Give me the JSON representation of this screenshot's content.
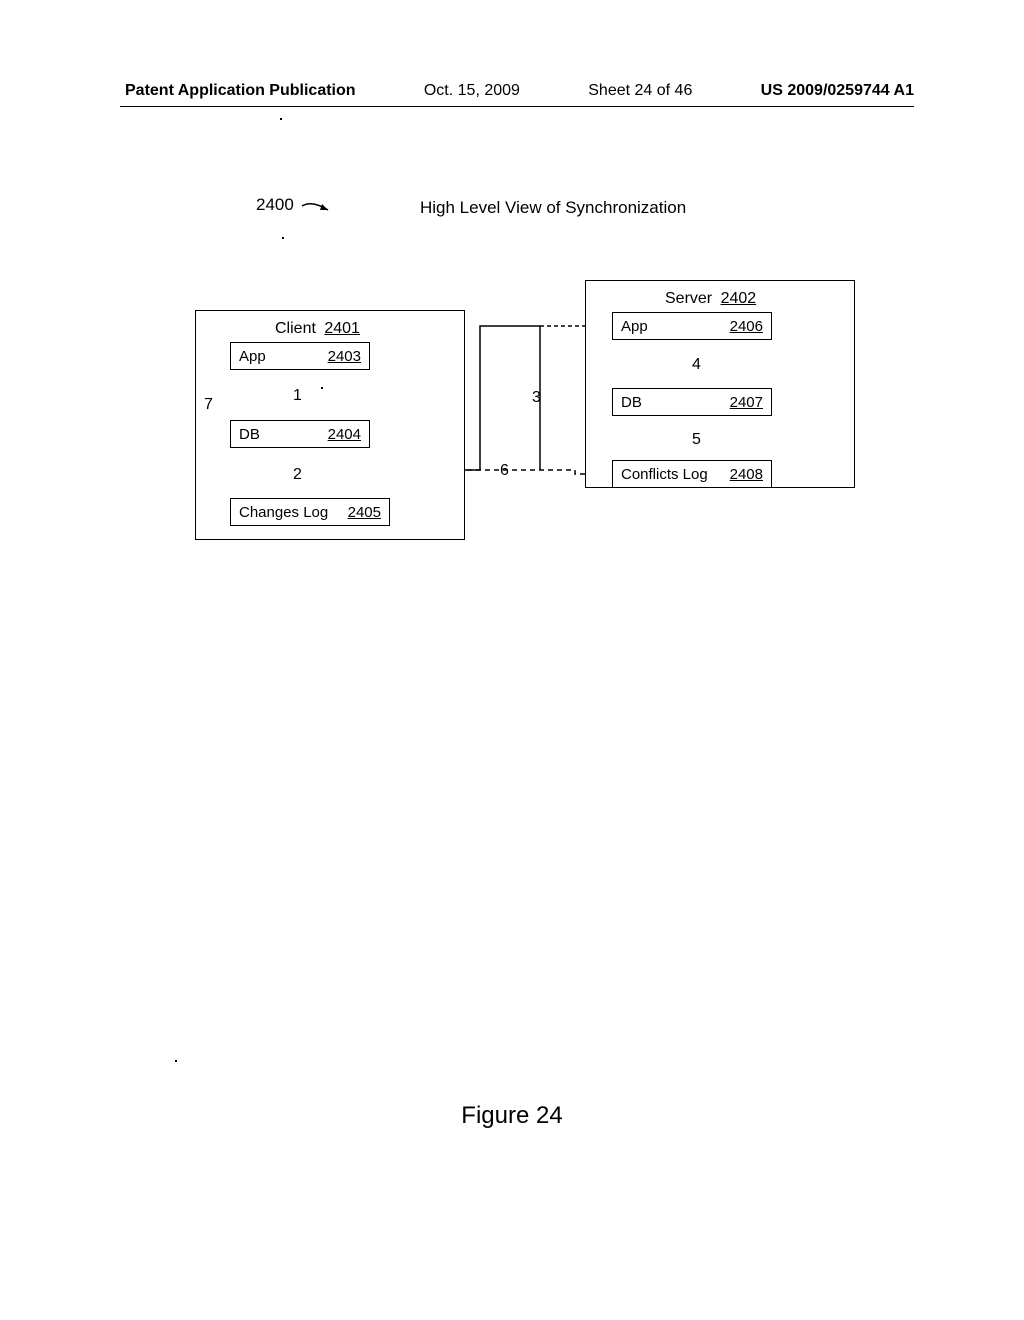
{
  "header": {
    "publication": "Patent Application Publication",
    "date": "Oct. 15, 2009",
    "sheet": "Sheet 24 of 46",
    "pubnum": "US 2009/0259744 A1"
  },
  "figure": {
    "ref": "2400",
    "title": "High Level View of Synchronization",
    "caption": "Figure 24"
  },
  "client": {
    "label": "Client",
    "ref": "2401",
    "app": {
      "label": "App",
      "ref": "2403"
    },
    "db": {
      "label": "DB",
      "ref": "2404"
    },
    "log": {
      "label": "Changes Log",
      "ref": "2405"
    }
  },
  "server": {
    "label": "Server",
    "ref": "2402",
    "app": {
      "label": "App",
      "ref": "2406"
    },
    "db": {
      "label": "DB",
      "ref": "2407"
    },
    "log": {
      "label": "Conflicts Log",
      "ref": "2408"
    }
  },
  "edges": {
    "e1": "1",
    "e2": "2",
    "e3": "3",
    "e4": "4",
    "e5": "5",
    "e6": "6",
    "e7": "7"
  }
}
